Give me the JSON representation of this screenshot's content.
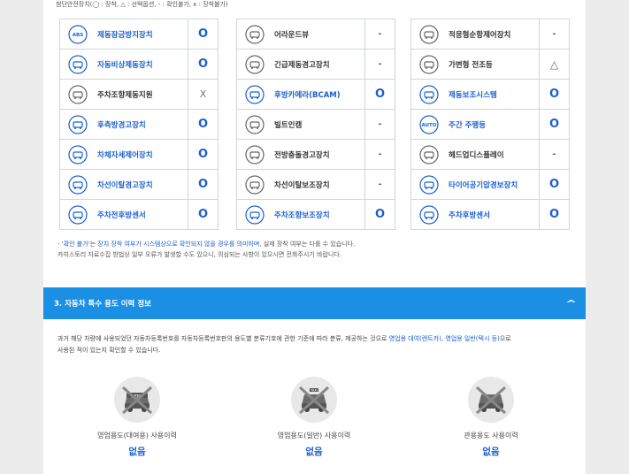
{
  "legend": "첨단안전장치(◯ : 장착, △ : 선택옵션, - : 확인불가, x : 장착불가)",
  "columns": [
    [
      {
        "label": "제동잠금방지장치",
        "value": "O",
        "icon": "abs-icon",
        "icon_text": "ABS",
        "style": "blue"
      },
      {
        "label": "자동비상제동장치",
        "value": "O",
        "icon": "emergency-brake-icon",
        "style": "blue"
      },
      {
        "label": "주차조향제동지원",
        "value": "X",
        "icon": "steering-wheel-icon",
        "style": "dark"
      },
      {
        "label": "후측방경고장치",
        "value": "O",
        "icon": "blind-spot-icon",
        "style": "blue"
      },
      {
        "label": "차체자세제어장치",
        "value": "O",
        "icon": "stability-control-icon",
        "style": "blue"
      },
      {
        "label": "차선이탈경고장치",
        "value": "O",
        "icon": "lane-departure-warning-icon",
        "style": "blue"
      },
      {
        "label": "주차전후방센서",
        "value": "O",
        "icon": "parking-sensor-icon",
        "style": "blue"
      }
    ],
    [
      {
        "label": "어라운드뷰",
        "value": "-",
        "icon": "around-view-icon",
        "style": "dark"
      },
      {
        "label": "긴급제동경고장치",
        "value": "-",
        "icon": "brake-warning-icon",
        "style": "dark"
      },
      {
        "label": "후방카메라(BCAM)",
        "value": "O",
        "icon": "rear-camera-icon",
        "style": "blue"
      },
      {
        "label": "빌트인캠",
        "value": "-",
        "icon": "builtin-cam-icon",
        "style": "dark"
      },
      {
        "label": "전방충돌경고장치",
        "value": "-",
        "icon": "forward-collision-icon",
        "style": "dark"
      },
      {
        "label": "차선이탈보조장치",
        "value": "-",
        "icon": "lane-keep-assist-icon",
        "style": "dark"
      },
      {
        "label": "주차조향보조장치",
        "value": "O",
        "icon": "parking-steer-assist-icon",
        "style": "blue"
      }
    ],
    [
      {
        "label": "적응형순항제어장치",
        "value": "-",
        "icon": "adaptive-cruise-icon",
        "style": "dark"
      },
      {
        "label": "가변형 전조등",
        "value": "△",
        "icon": "adaptive-headlight-icon",
        "style": "dark"
      },
      {
        "label": "제동보조시스템",
        "value": "O",
        "icon": "brake-assist-icon",
        "style": "blue"
      },
      {
        "label": "주간 주행등",
        "value": "O",
        "icon": "daytime-running-light-icon",
        "icon_text": "AUTO",
        "style": "blue"
      },
      {
        "label": "헤드업디스플레이",
        "value": "-",
        "icon": "head-up-display-icon",
        "style": "dark"
      },
      {
        "label": "타이어공기압경보장치",
        "value": "O",
        "icon": "tire-pressure-icon",
        "style": "blue"
      },
      {
        "label": "주차후방센서",
        "value": "O",
        "icon": "rear-parking-sensor-icon",
        "style": "blue"
      }
    ]
  ],
  "notes": {
    "line1_prefix": "- '",
    "line1_hl": "확인 불가",
    "line1_mid": "'는 ",
    "line1_hl2": "장치 장착 여부가 시스템상으로 확인되지 않을 경우를 의미하며",
    "line1_suffix": ", 실제 장착 여부는 다를 수 있습니다.",
    "line2": "카히스토리 자료수집 방법상 일부 오류가 발생할 수도 있으니, 의심되는 사항이 있으시면 전화주시기 바랍니다."
  },
  "section3": {
    "title": "3. 자동차 특수 용도 이력 정보",
    "chevron": "^",
    "desc_part1": "과거 해당 차량에 사용되었던 자동차등록번호를 자동차등록번호판의 용도별 분류기호에 관한 기준에 따라 분류, 제공하는 것으로 ",
    "desc_hl1": "영업용 대여(렌트카)",
    "desc_sep": ", ",
    "desc_hl2": "영업용 일반(택시 등)",
    "desc_part2": "으로",
    "desc_line2": "사용된 적이 있는지 확인할 수 있습니다.",
    "items": [
      {
        "label": "영업용도(대여용) 사용이력",
        "value": "없음",
        "icon": "rental-car-crossed-icon"
      },
      {
        "label": "영업용도(일반) 사용이력",
        "value": "없음",
        "icon": "taxi-crossed-icon"
      },
      {
        "label": "관용용도 사용이력",
        "value": "없음",
        "icon": "government-car-crossed-icon"
      }
    ]
  },
  "colors": {
    "accent": "#1a5fcf",
    "bar": "#1a8fe3",
    "border": "#cfd6dc"
  }
}
